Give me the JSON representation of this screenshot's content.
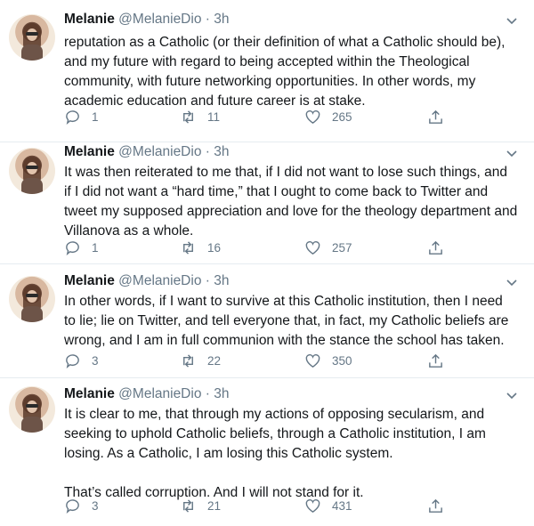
{
  "author": {
    "name": "Melanie",
    "handle": "@MelanieDio",
    "dot": "·"
  },
  "tweets": [
    {
      "time": "3h",
      "paragraphs": [
        "reputation as a Catholic (or their definition of what a Catholic should be), and my future with regard to being accepted within the Theological community, with future networking opportunities. In other words, my academic education and future career is at stake."
      ],
      "replies": "1",
      "retweets": "11",
      "likes": "265"
    },
    {
      "time": "3h",
      "paragraphs": [
        "It was then reiterated to me that, if I did not want to lose such things, and if I did not want a “hard time,” that I ought to come back to Twitter and tweet my supposed appreciation and love for the theology department and Villanova as a whole."
      ],
      "replies": "1",
      "retweets": "16",
      "likes": "257"
    },
    {
      "time": "3h",
      "paragraphs": [
        "In other words, if I want to survive at this Catholic institution, then I need to lie; lie on Twitter, and tell everyone that, in fact, my Catholic beliefs are wrong, and I am in full communion with the stance the school has taken."
      ],
      "replies": "3",
      "retweets": "22",
      "likes": "350"
    },
    {
      "time": "3h",
      "paragraphs": [
        "It is clear to me, that through my actions of opposing secularism, and seeking to uphold Catholic beliefs, through a Catholic institution, I am losing. As a Catholic, I am losing this Catholic system.",
        "That’s called corruption. And I will not stand for it."
      ],
      "replies": "3",
      "retweets": "21",
      "likes": "431"
    }
  ],
  "icons": {
    "avatar": "profile-photo",
    "menu": "chevron-down-icon",
    "reply": "reply-icon",
    "retweet": "retweet-icon",
    "like": "heart-icon",
    "share": "share-icon"
  },
  "colors": {
    "text": "#14171a",
    "secondary": "#657786",
    "divider": "#e6ecf0"
  }
}
